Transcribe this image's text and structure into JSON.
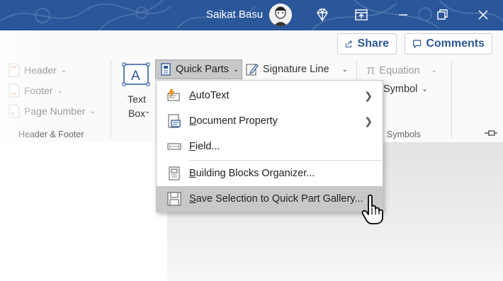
{
  "titlebar": {
    "user_name": "Saikat Basu",
    "icons": [
      "diamond-icon",
      "ribbon-display-icon",
      "minimize-icon",
      "restore-icon",
      "close-icon"
    ],
    "color": "#2b579a"
  },
  "toolbar": {
    "share_label": "Share",
    "comments_label": "Comments"
  },
  "ribbon": {
    "header_footer": {
      "header_label": "Header",
      "footer_label": "Footer",
      "page_number_label": "Page Number",
      "group_label": "Header & Footer"
    },
    "text": {
      "textbox_label_1": "Text",
      "textbox_label_2": "Box",
      "quick_parts_label": "Quick Parts",
      "signature_line_label": "Signature Line"
    },
    "symbols": {
      "equation_label": "Equation",
      "symbol_label": "Symbol",
      "group_label": "Symbols"
    }
  },
  "menu": {
    "items": [
      {
        "label_u": "A",
        "label_rest": "utoText",
        "has_submenu": true
      },
      {
        "label_u": "D",
        "label_rest": "ocument Property",
        "has_submenu": true
      },
      {
        "label_u": "F",
        "label_rest": "ield...",
        "has_submenu": false
      },
      {
        "label_u": "B",
        "label_rest": "uilding Blocks Organizer...",
        "has_submenu": false
      },
      {
        "label_u": "S",
        "label_rest": "ave Selection to Quick Part Gallery...",
        "has_submenu": false
      }
    ]
  }
}
